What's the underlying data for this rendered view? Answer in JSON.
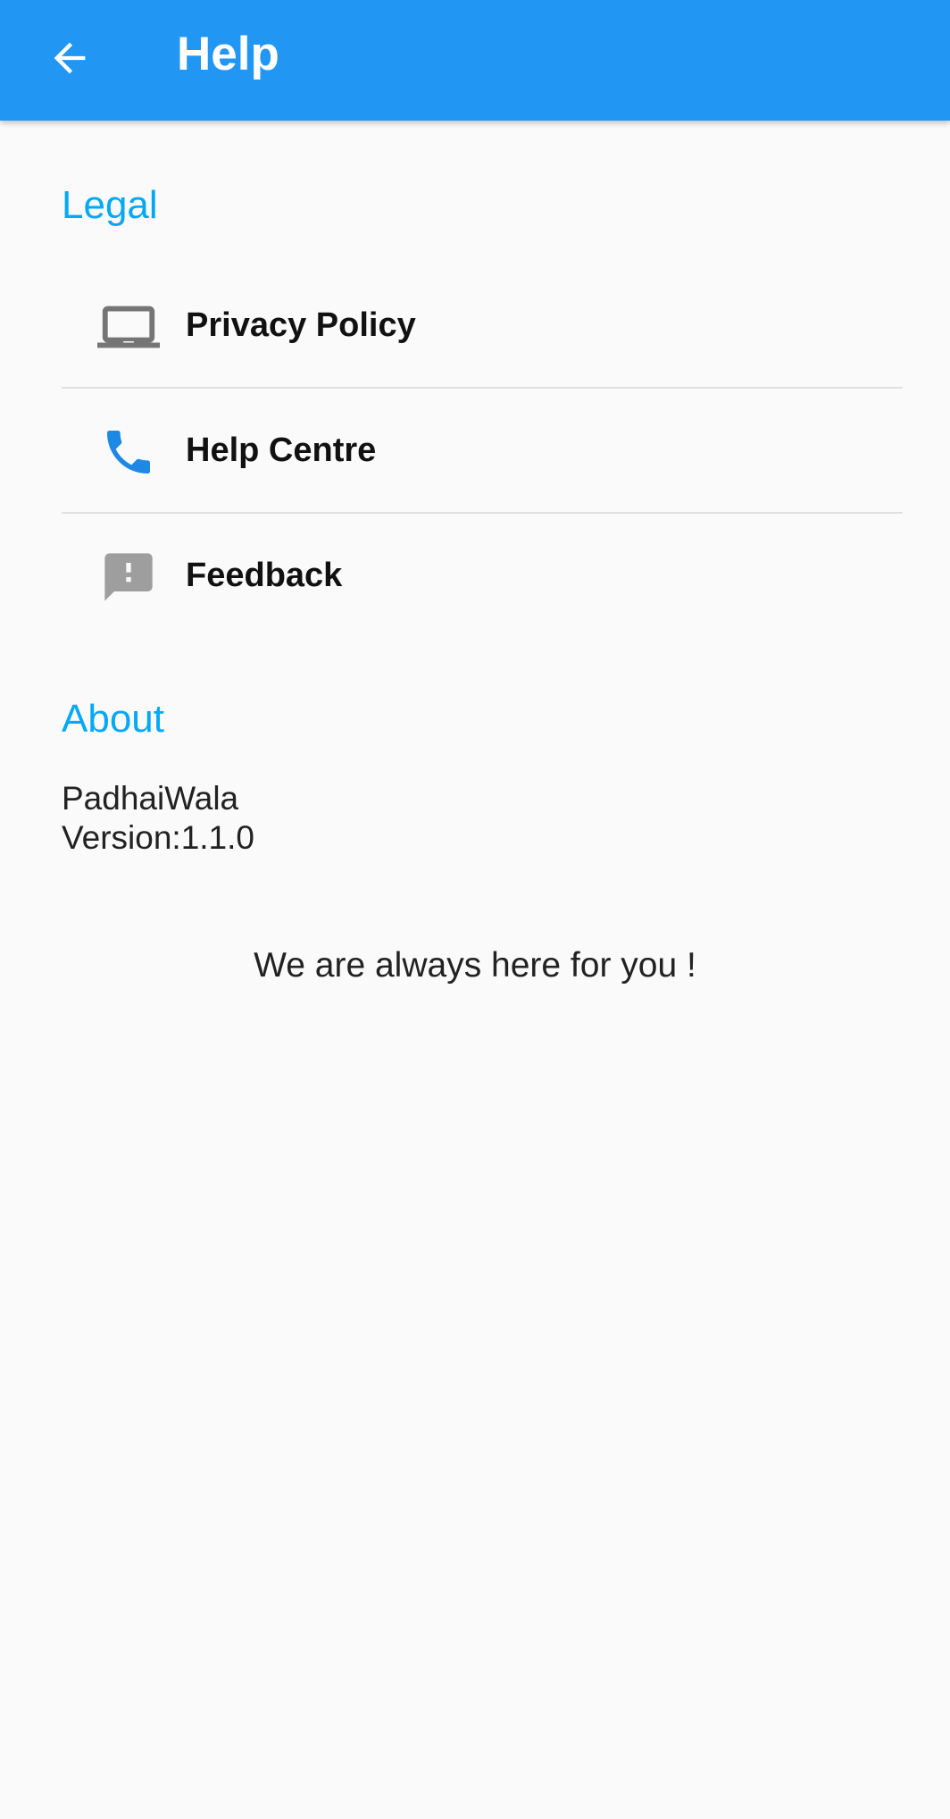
{
  "app_bar": {
    "title": "Help",
    "background": "#2196f3",
    "back_icon": "arrow-back-icon"
  },
  "sections": {
    "legal": {
      "title": "Legal",
      "items": [
        {
          "label": "Privacy Policy",
          "icon": "laptop-icon",
          "icon_color": "#757575"
        },
        {
          "label": "Help Centre",
          "icon": "phone-icon",
          "icon_color": "#1e88e5"
        },
        {
          "label": "Feedback",
          "icon": "feedback-icon",
          "icon_color": "#9e9e9e"
        }
      ]
    },
    "about": {
      "title": "About",
      "app_name": "PadhaiWala",
      "version": "Version:1.1.0"
    }
  },
  "tagline": "We are always here for you !",
  "colors": {
    "accent": "#03a9f4",
    "primary": "#2196f3",
    "background": "#fafafa"
  }
}
